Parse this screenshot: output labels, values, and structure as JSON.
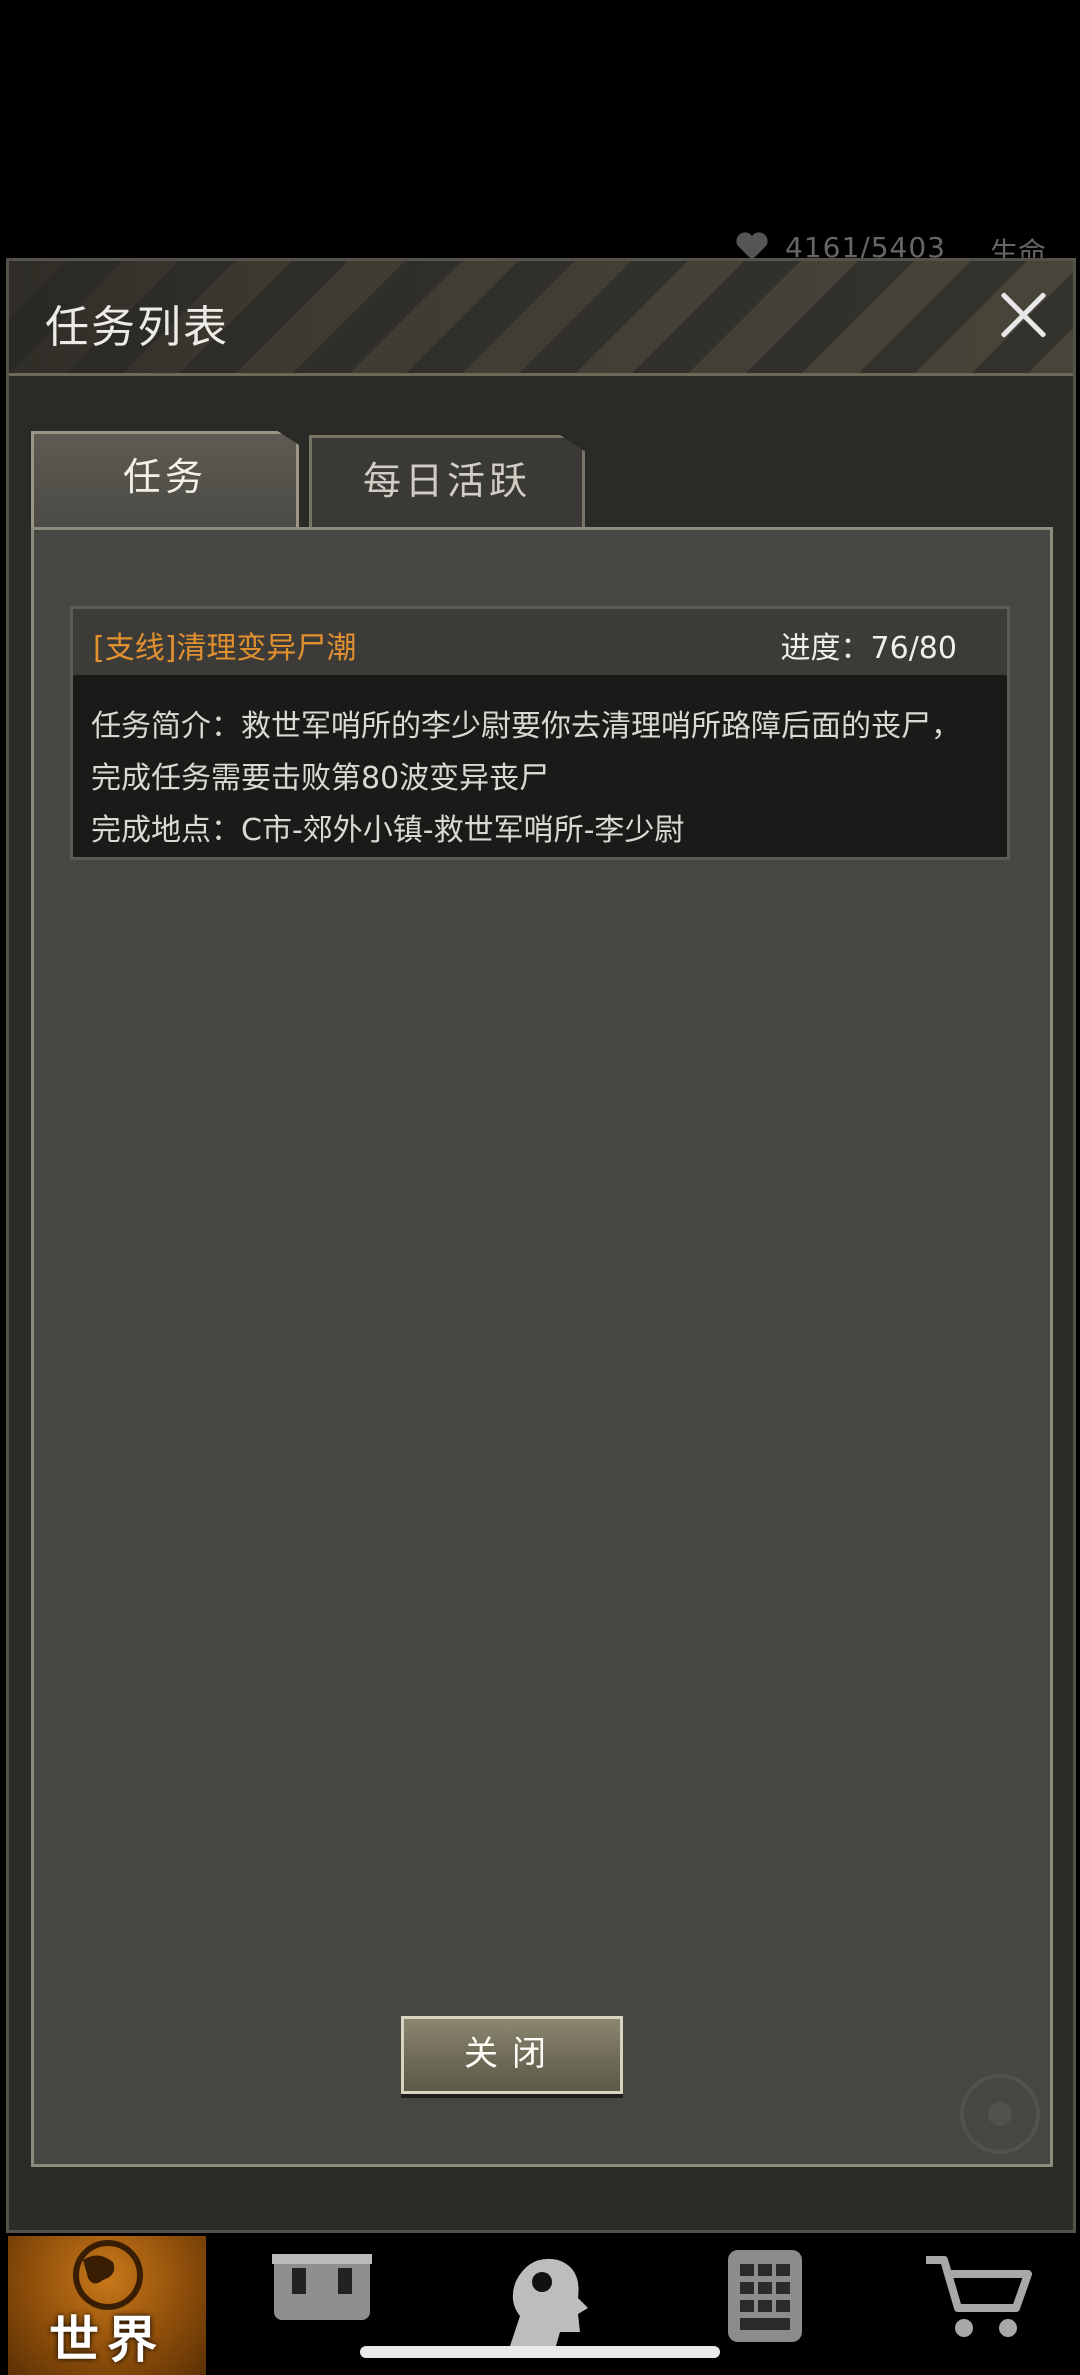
{
  "background_status": {
    "hp_text": "4161/5403",
    "life_text": "生命"
  },
  "dialog": {
    "title": "任务列表",
    "tabs": [
      {
        "label": "任务",
        "active": true
      },
      {
        "label": "每日活跃",
        "active": false
      }
    ],
    "quest": {
      "name": "[支线]清理变异尸潮",
      "progress": "进度：76/80",
      "description": "任务简介：救世军哨所的李少尉要你去清理哨所路障后面的丧尸，完成任务需要击败第80波变异丧尸",
      "location": "完成地点：C市-郊外小镇-救世军哨所-李少尉"
    },
    "close_button_label": "关闭"
  },
  "bottom_nav": {
    "items": [
      {
        "label": "世界",
        "icon": "globe-icon",
        "active": true
      },
      {
        "label": "",
        "icon": "backpack-icon",
        "active": false
      },
      {
        "label": "",
        "icon": "head-profile-icon",
        "active": false
      },
      {
        "label": "",
        "icon": "phone-keypad-icon",
        "active": false
      },
      {
        "label": "",
        "icon": "cart-icon",
        "active": false
      }
    ]
  },
  "colors": {
    "quest_name": "#e0902f",
    "panel_bg": "#464642",
    "nav_active": "#c8781a"
  }
}
